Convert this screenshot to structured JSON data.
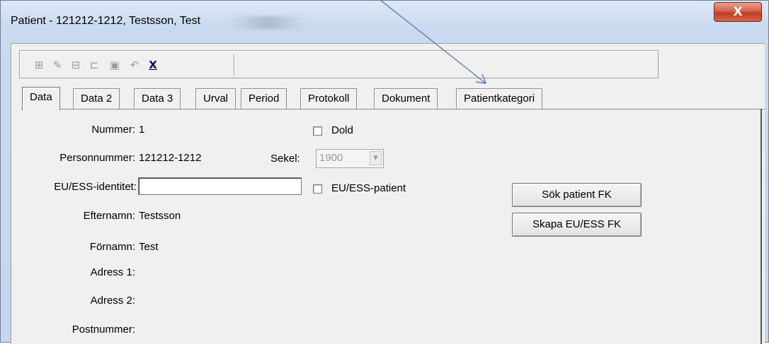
{
  "window": {
    "title": "Patient - 121212-1212, Testsson, Test",
    "close_glyph": "X"
  },
  "toolbar": {
    "icons": [
      {
        "name": "add-record-icon",
        "glyph": "⊞"
      },
      {
        "name": "edit-record-icon",
        "glyph": "✎"
      },
      {
        "name": "delete-record-icon",
        "glyph": "⊟"
      },
      {
        "name": "cancel-record-icon",
        "glyph": "⊏"
      },
      {
        "name": "save-record-icon",
        "glyph": "▣"
      },
      {
        "name": "undo-icon",
        "glyph": "↶"
      },
      {
        "name": "close-x-icon",
        "glyph": "X"
      }
    ]
  },
  "tabs": [
    "Data",
    "Data 2",
    "Data 3",
    "Urval",
    "Period",
    "Protokoll",
    "Dokument",
    "Patientkategori"
  ],
  "form": {
    "nummer_label": "Nummer:",
    "nummer_value": "1",
    "personnummer_label": "Personnummer:",
    "personnummer_value": "121212-1212",
    "euess_label": "EU/ESS-identitet:",
    "euess_value": "",
    "efternamn_label": "Efternamn:",
    "efternamn_value": "Testsson",
    "fornamn_label": "Förnamn:",
    "fornamn_value": "Test",
    "adress1_label": "Adress 1:",
    "adress2_label": "Adress 2:",
    "postnummer_label": "Postnummer:",
    "dold_label": "Dold",
    "sekel_label": "Sekel:",
    "sekel_value": "1900",
    "euess_patient_label": "EU/ESS-patient",
    "sok_button": "Sök patient FK",
    "skapa_button": "Skapa EU/ESS FK"
  },
  "colors": {
    "arrow": "#5b7fb5",
    "close_button": "#c9442c"
  }
}
